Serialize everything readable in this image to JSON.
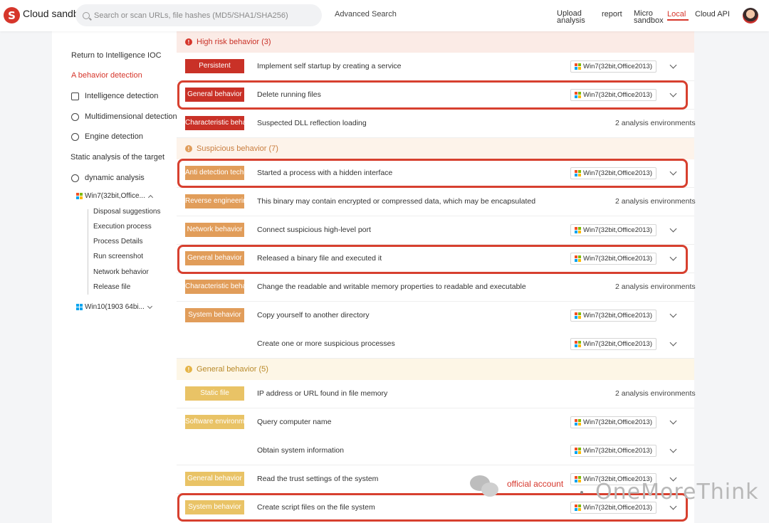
{
  "header": {
    "brand": "Cloud sandbox",
    "search_placeholder": "Search or scan URLs, file hashes (MD5/SHA1/SHA256)",
    "advanced_search": "Advanced Search",
    "nav": [
      "Upload analysis",
      "report",
      "Micro sandbox",
      "Local",
      "Cloud API"
    ]
  },
  "sidebar": {
    "return": "Return to Intelligence IOC",
    "behavior": "A behavior detection",
    "intelligence": "Intelligence detection",
    "multidimensional": "Multidimensional detection",
    "engine": "Engine detection",
    "static": "Static analysis of the target",
    "dynamic": "dynamic analysis",
    "env1": "Win7(32bit,Office...",
    "env1_items": [
      "Disposal suggestions",
      "Execution process",
      "Process Details",
      "Run screenshot",
      "Network behavior",
      "Release file"
    ],
    "env2": "Win10(1903 64bi..."
  },
  "sections": {
    "high": "High risk behavior (3)",
    "suspicious": "Suspicious behavior (7)",
    "general": "General behavior (5)"
  },
  "rows": [
    {
      "tag": "Persistent",
      "desc": "Implement self startup by creating a service",
      "env": "Win7(32bit,Office2013)"
    },
    {
      "tag": "General behavior",
      "desc": "Delete running files",
      "env": "Win7(32bit,Office2013)"
    },
    {
      "tag": "Characteristic behavior",
      "desc": "Suspected DLL reflection loading",
      "env": "2 analysis environments"
    },
    {
      "tag": "Anti detection technology",
      "desc": "Started a process with a hidden interface",
      "env": "Win7(32bit,Office2013)"
    },
    {
      "tag": "Reverse engineering",
      "desc": "This binary may contain encrypted or compressed data, which may be encapsulated",
      "env": "2 analysis environments"
    },
    {
      "tag": "Network behavior",
      "desc": "Connect suspicious high-level port",
      "env": "Win7(32bit,Office2013)"
    },
    {
      "tag": "General behavior",
      "desc": "Released a binary file and executed it",
      "env": "Win7(32bit,Office2013)"
    },
    {
      "tag": "Characteristic behavior",
      "desc": "Change the readable and writable memory properties to readable and executable",
      "env": "2 analysis environments"
    },
    {
      "tag": "System behavior",
      "desc": "Copy yourself to another directory",
      "env": "Win7(32bit,Office2013)"
    },
    {
      "tag": "",
      "desc": "Create one or more suspicious processes",
      "env": "Win7(32bit,Office2013)"
    },
    {
      "tag": "Static file",
      "desc": "IP address or URL found in file memory",
      "env": "2 analysis environments"
    },
    {
      "tag": "Software environment",
      "desc": "Query computer name",
      "env": "Win7(32bit,Office2013)"
    },
    {
      "tag": "",
      "desc": "Obtain system information",
      "env": "Win7(32bit,Office2013)"
    },
    {
      "tag": "General behavior",
      "desc": "Read the trust settings of the system",
      "env": "Win7(32bit,Office2013)"
    },
    {
      "tag": "System behavior",
      "desc": "Create script files on the file system",
      "env": "Win7(32bit,Office2013)"
    }
  ],
  "watermark": {
    "label": "official account",
    "brand": "OneMoreThink"
  },
  "colors": {
    "accent": "#d6362b",
    "high": "#c93127",
    "suspicious": "#e19d5a",
    "general": "#e9c366"
  }
}
